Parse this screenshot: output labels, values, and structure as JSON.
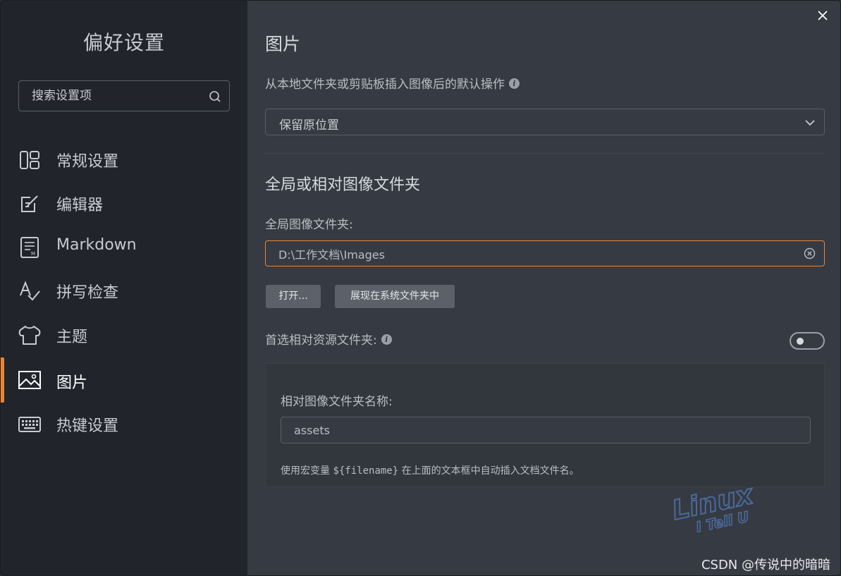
{
  "sidebar": {
    "title": "偏好设置",
    "search_placeholder": "搜索设置项",
    "items": [
      {
        "label": "常规设置",
        "icon": "layout-grid-icon"
      },
      {
        "label": "编辑器",
        "icon": "edit-icon"
      },
      {
        "label": "Markdown",
        "icon": "markdown-doc-icon"
      },
      {
        "label": "拼写检查",
        "icon": "spellcheck-icon"
      },
      {
        "label": "主题",
        "icon": "shirt-icon"
      },
      {
        "label": "图片",
        "icon": "image-icon",
        "active": true
      },
      {
        "label": "热键设置",
        "icon": "keyboard-icon"
      }
    ]
  },
  "main": {
    "title": "图片",
    "insert_action_label": "从本地文件夹或剪贴板插入图像后的默认操作",
    "insert_action_value": "保留原位置",
    "section_title": "全局或相对图像文件夹",
    "global_folder_label": "全局图像文件夹:",
    "global_folder_value": "D:\\工作文档\\Images",
    "open_button": "打开...",
    "reveal_button": "展现在系统文件夹中",
    "prefer_relative_label": "首选相对资源文件夹:",
    "prefer_relative_enabled": false,
    "relative_folder_label": "相对图像文件夹名称:",
    "relative_folder_value": "assets",
    "hint_prefix": "使用宏变量 ",
    "hint_code": "${filename}",
    "hint_suffix": " 在上面的文本框中自动插入文档文件名。"
  },
  "watermark": {
    "logo_line1": "Linux",
    "logo_line2": "I Tell U",
    "credit": "CSDN @传说中的暗暗"
  },
  "colors": {
    "accent": "#e8863a",
    "sidebar_bg": "#21252b",
    "main_bg": "#363a42",
    "watermark_blue": "#4a6a9a"
  }
}
